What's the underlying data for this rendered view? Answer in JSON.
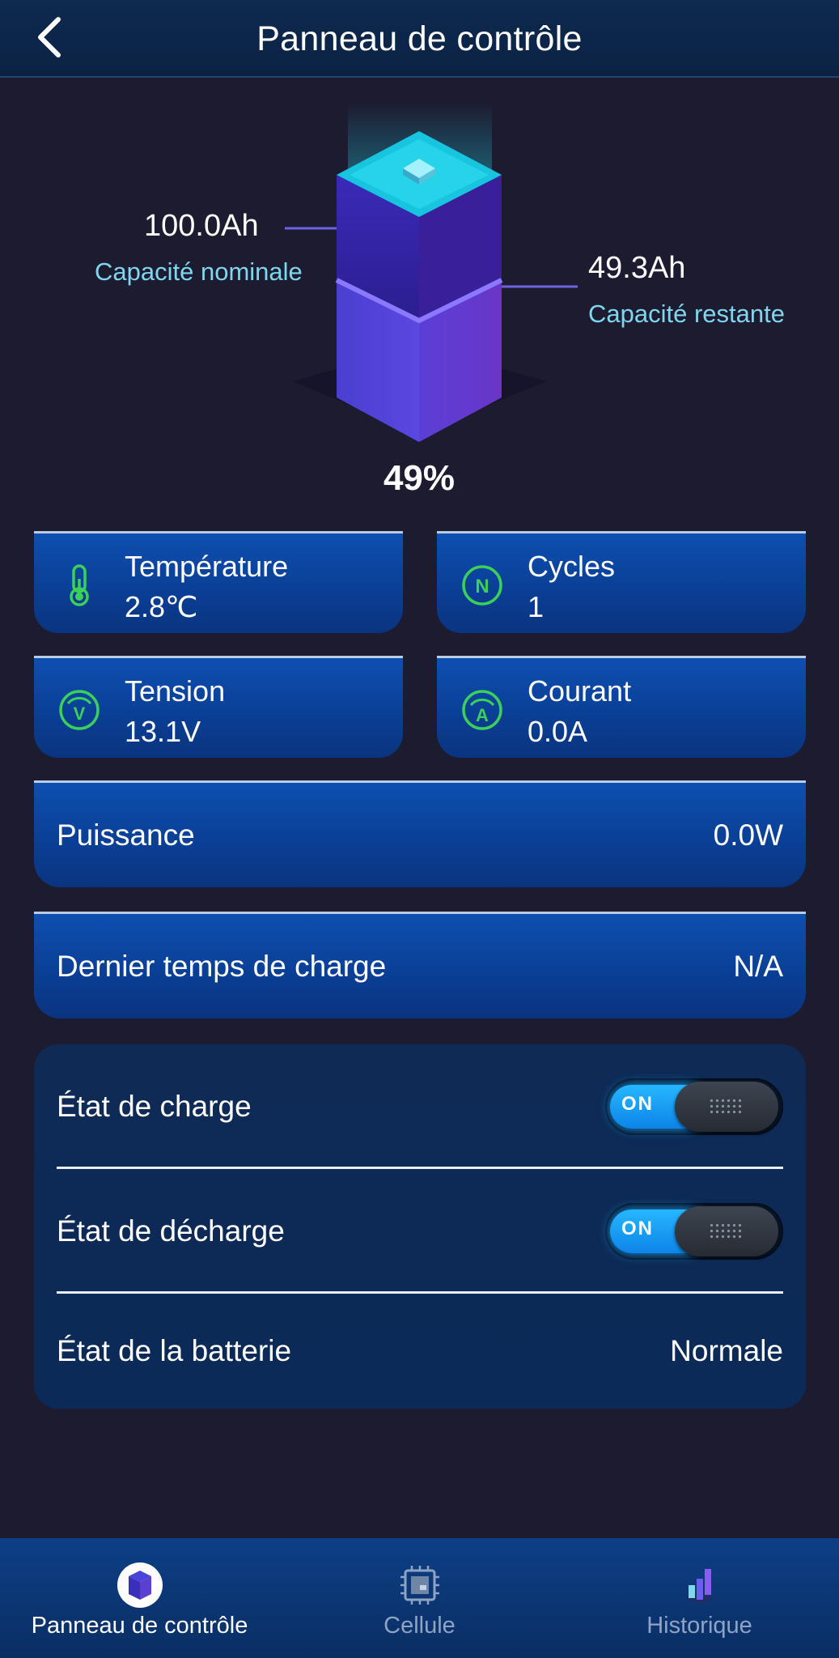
{
  "header": {
    "title": "Panneau de contrôle"
  },
  "battery": {
    "nominal_capacity": "100.0Ah",
    "nominal_label": "Capacité nominale",
    "remaining_capacity": "49.3Ah",
    "remaining_label": "Capacité restante",
    "soc": "49%",
    "soc_fraction": 0.49
  },
  "cards": [
    {
      "label": "Température",
      "value": "2.8℃",
      "icon": "thermometer-icon"
    },
    {
      "label": "Cycles",
      "value": "1",
      "icon": "cycles-n-icon"
    },
    {
      "label": "Tension",
      "value": "13.1V",
      "icon": "voltage-v-icon"
    },
    {
      "label": "Courant",
      "value": "0.0A",
      "icon": "current-a-icon"
    }
  ],
  "rows": {
    "power": {
      "label": "Puissance",
      "value": "0.0W"
    },
    "last_charge": {
      "label": "Dernier temps de charge",
      "value": "N/A"
    }
  },
  "status": {
    "charge": {
      "label": "État de charge",
      "toggle": "ON"
    },
    "discharge": {
      "label": "État de décharge",
      "toggle": "ON"
    },
    "battery": {
      "label": "État de la batterie",
      "value": "Normale"
    }
  },
  "bottom_nav": [
    {
      "label": "Panneau de contrôle",
      "icon": "battery-cube-icon",
      "active": true
    },
    {
      "label": "Cellule",
      "icon": "chip-icon",
      "active": false
    },
    {
      "label": "Historique",
      "icon": "bar-chart-icon",
      "active": false
    }
  ],
  "colors": {
    "background": "#1d1b30",
    "card_blue": "#0a3e94",
    "accent_cyan": "#7fd6ee",
    "icon_green": "#3ad05a",
    "toggle_on": "#1aa6ff"
  }
}
